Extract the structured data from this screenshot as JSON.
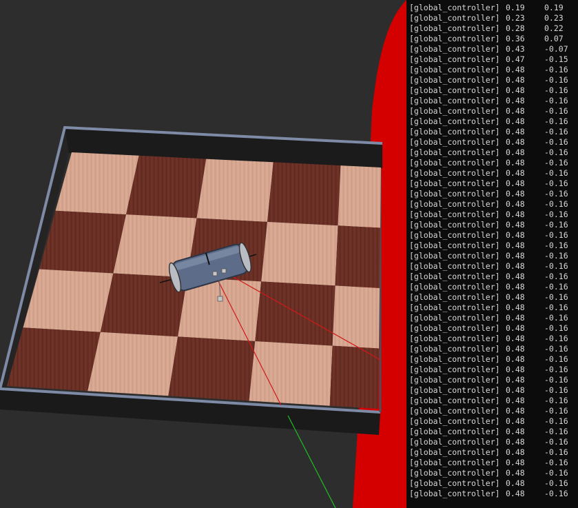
{
  "console": {
    "tag": "[global_controller]",
    "lines": [
      {
        "x": "0.19",
        "y": "0.19"
      },
      {
        "x": "0.23",
        "y": "0.23"
      },
      {
        "x": "0.28",
        "y": "0.22"
      },
      {
        "x": "0.36",
        "y": "0.07"
      },
      {
        "x": "0.43",
        "y": "-0.07"
      },
      {
        "x": "0.47",
        "y": "-0.15"
      },
      {
        "x": "0.48",
        "y": "-0.16"
      },
      {
        "x": "0.48",
        "y": "-0.16"
      },
      {
        "x": "0.48",
        "y": "-0.16"
      },
      {
        "x": "0.48",
        "y": "-0.16"
      },
      {
        "x": "0.48",
        "y": "-0.16"
      },
      {
        "x": "0.48",
        "y": "-0.16"
      },
      {
        "x": "0.48",
        "y": "-0.16"
      },
      {
        "x": "0.48",
        "y": "-0.16"
      },
      {
        "x": "0.48",
        "y": "-0.16"
      },
      {
        "x": "0.48",
        "y": "-0.16"
      },
      {
        "x": "0.48",
        "y": "-0.16"
      },
      {
        "x": "0.48",
        "y": "-0.16"
      },
      {
        "x": "0.48",
        "y": "-0.16"
      },
      {
        "x": "0.48",
        "y": "-0.16"
      },
      {
        "x": "0.48",
        "y": "-0.16"
      },
      {
        "x": "0.48",
        "y": "-0.16"
      },
      {
        "x": "0.48",
        "y": "-0.16"
      },
      {
        "x": "0.48",
        "y": "-0.16"
      },
      {
        "x": "0.48",
        "y": "-0.16"
      },
      {
        "x": "0.48",
        "y": "-0.16"
      },
      {
        "x": "0.48",
        "y": "-0.16"
      },
      {
        "x": "0.48",
        "y": "-0.16"
      },
      {
        "x": "0.48",
        "y": "-0.16"
      },
      {
        "x": "0.48",
        "y": "-0.16"
      },
      {
        "x": "0.48",
        "y": "-0.16"
      },
      {
        "x": "0.48",
        "y": "-0.16"
      },
      {
        "x": "0.48",
        "y": "-0.16"
      },
      {
        "x": "0.48",
        "y": "-0.16"
      },
      {
        "x": "0.48",
        "y": "-0.16"
      },
      {
        "x": "0.48",
        "y": "-0.16"
      },
      {
        "x": "0.48",
        "y": "-0.16"
      },
      {
        "x": "0.48",
        "y": "-0.16"
      },
      {
        "x": "0.48",
        "y": "-0.16"
      },
      {
        "x": "0.48",
        "y": "-0.16"
      },
      {
        "x": "0.48",
        "y": "-0.16"
      },
      {
        "x": "0.48",
        "y": "-0.16"
      },
      {
        "x": "0.48",
        "y": "-0.16"
      },
      {
        "x": "0.48",
        "y": "-0.16"
      },
      {
        "x": "0.48",
        "y": "-0.16"
      },
      {
        "x": "0.48",
        "y": "-0.16"
      },
      {
        "x": "0.48",
        "y": "-0.16"
      },
      {
        "x": "0.48",
        "y": "-0.16"
      }
    ]
  },
  "scene": {
    "colors": {
      "background": "#2d2d2d",
      "light_tile": "#d4a48c",
      "dark_tile": "#6a2f24",
      "wall_top": "#7e8ba6",
      "wall_side": "#1b1b1b",
      "robot_body": "#5d6c88",
      "laser": "#d01818",
      "axis_green": "#20c020",
      "red_panel": "#d40000"
    }
  }
}
